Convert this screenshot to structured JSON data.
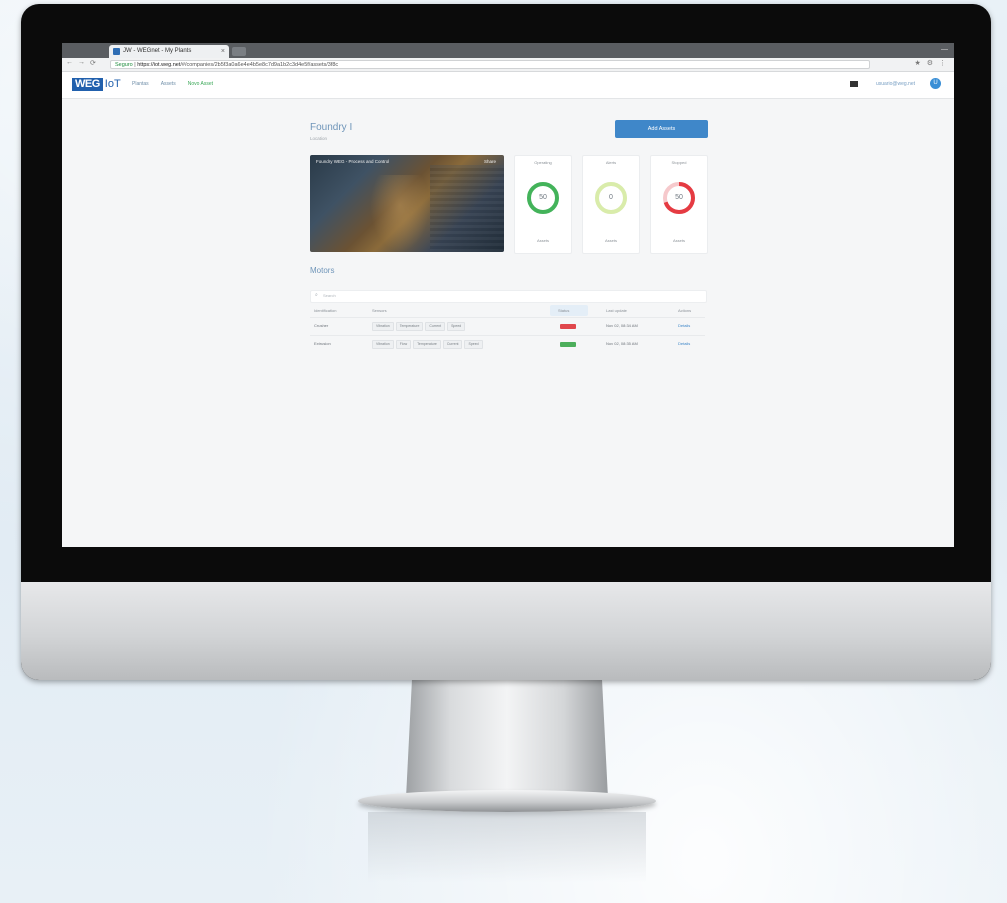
{
  "browser": {
    "tab_title": "JW - WEGnet - My Plants",
    "tab_close": "×",
    "url_secure": "Seguro",
    "url_domain": "https://iot.weg.net",
    "url_path": "/#/companies/2b5f3a0a6e4e4b5e8c7d9a1b2c3d4e5f/assets/3f8c",
    "nav_back": "←",
    "nav_forward": "→",
    "nav_reload": "⟳",
    "icons": "★ ⚙ ⋮",
    "window_control": "—"
  },
  "app": {
    "logo_text": "WEG",
    "logo_suffix": "IoT",
    "nav": [
      "Plantas",
      "Assets",
      "Novo Asset"
    ],
    "username": "usuario@weg.net",
    "avatar_initial": "U"
  },
  "page": {
    "title": "Foundry I",
    "subtitle": "Location",
    "primary_button": "Add Assets"
  },
  "video": {
    "caption": "Foundry WEG - Process and Control",
    "share": "Share"
  },
  "cards": [
    {
      "title": "Operating",
      "value": "50",
      "foot": "Assets",
      "color": "#43b35a",
      "percent": 100
    },
    {
      "title": "Alerts",
      "value": "0",
      "foot": "Assets",
      "color": "#d9ecaa",
      "percent": 100
    },
    {
      "title": "Stopped",
      "value": "50",
      "foot": "Assets",
      "color": "#e53b42",
      "percent": 70
    }
  ],
  "motors": {
    "title": "Motors",
    "search_placeholder": "Search",
    "columns": [
      "Identification",
      "Sensors",
      "Status",
      "Last update",
      "Actions"
    ],
    "rows": [
      {
        "id": "Crusher",
        "tags": [
          "Vibration",
          "Temperature",
          "Current",
          "Speed"
        ],
        "status_color": "#e0474c",
        "updated": "Nov 02, 08:34 AM",
        "action": "Details"
      },
      {
        "id": "Extrusion",
        "tags": [
          "Vibration",
          "Flow",
          "Temperature",
          "Current",
          "Speed"
        ],
        "status_color": "#4cae5b",
        "updated": "Nov 02, 08:35 AM",
        "action": "Details"
      }
    ]
  }
}
